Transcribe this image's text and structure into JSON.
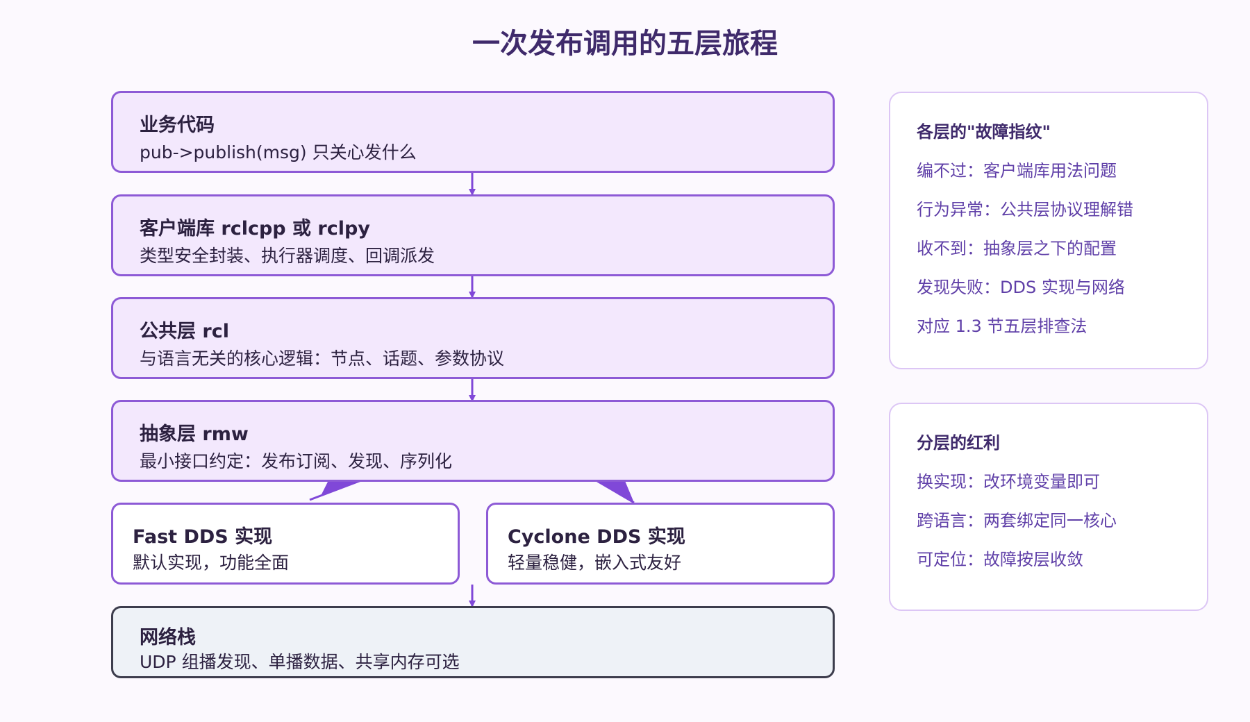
{
  "title": "一次发布调用的五层旅程",
  "layers": [
    {
      "name": "业务代码",
      "desc": "pub->publish(msg) 只关心发什么"
    },
    {
      "name": "客户端库 rclcpp 或 rclpy",
      "desc": "类型安全封装、执行器调度、回调派发"
    },
    {
      "name": "公共层 rcl",
      "desc": "与语言无关的核心逻辑：节点、话题、参数协议"
    },
    {
      "name": "抽象层 rmw",
      "desc": "最小接口约定：发布订阅、发现、序列化"
    }
  ],
  "implementations": [
    {
      "name": "Fast DDS 实现",
      "desc": "默认实现，功能全面"
    },
    {
      "name": "Cyclone DDS 实现",
      "desc": "轻量稳健，嵌入式友好"
    }
  ],
  "network": {
    "name": "网络栈",
    "desc": "UDP 组播发现、单播数据、共享内存可选"
  },
  "fault_panel": {
    "title": "各层的\"故障指纹\"",
    "items": [
      "编不过：客户端库用法问题",
      "行为异常：公共层协议理解错",
      "收不到：抽象层之下的配置",
      "发现失败：DDS 实现与网络",
      "对应 1.3 节五层排查法"
    ]
  },
  "benefit_panel": {
    "title": "分层的红利",
    "items": [
      "换实现：改环境变量即可",
      "跨语言：两套绑定同一核心",
      "可定位：故障按层收敛"
    ]
  },
  "colors": {
    "accent": "#8d5ad6",
    "layer_fill": "#f3e8fd",
    "network_fill": "#eef2f7",
    "title": "#3f2a6b",
    "panel_text": "#6040a8"
  }
}
